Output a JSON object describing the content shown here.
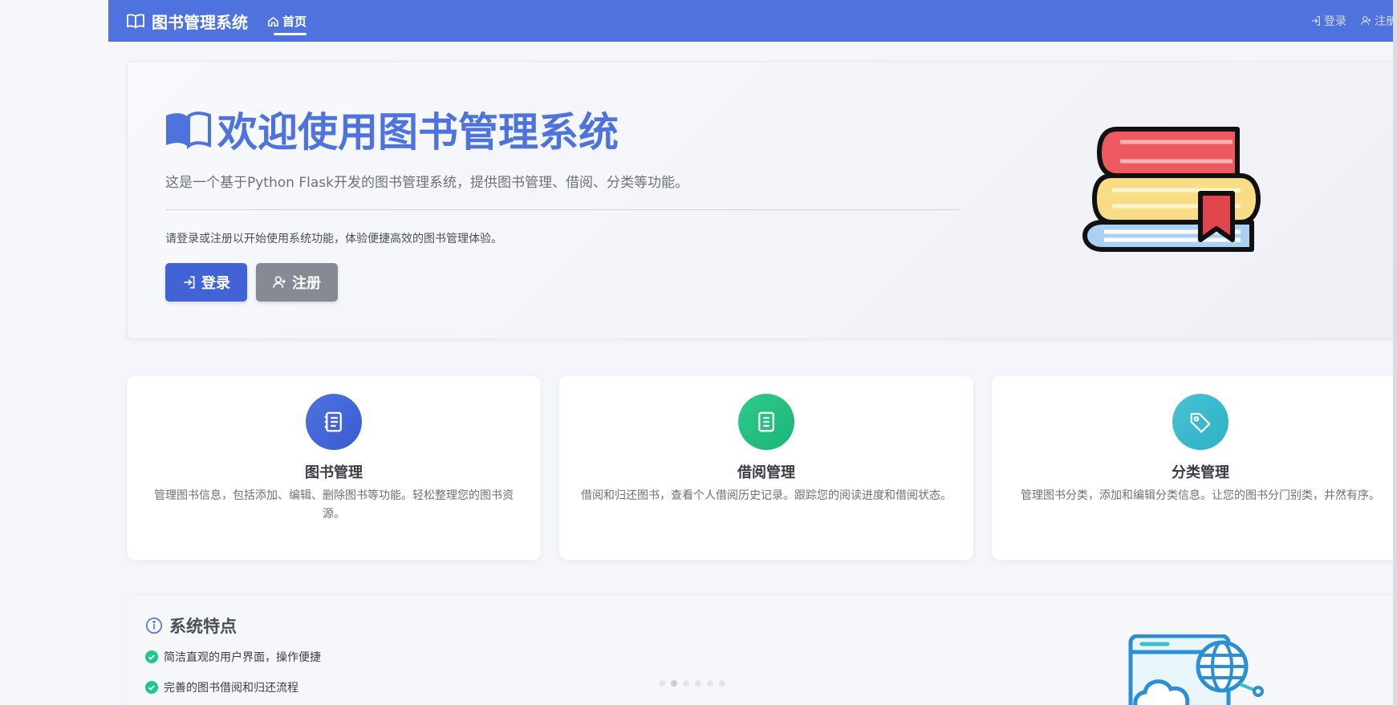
{
  "navbar": {
    "brand": "图书管理系统",
    "home": "首页",
    "login": "登录",
    "register": "注册"
  },
  "hero": {
    "title": "欢迎使用图书管理系统",
    "lead": "这是一个基于Python Flask开发的图书管理系统，提供图书管理、借阅、分类等功能。",
    "sub": "请登录或注册以开始使用系统功能，体验便捷高效的图书管理体验。",
    "login_button": "登录",
    "register_button": "注册"
  },
  "cards": [
    {
      "title": "图书管理",
      "desc": "管理图书信息，包括添加、编辑、删除图书等功能。轻松整理您的图书资源。",
      "icon": "notebook-icon",
      "color": "#4e73df"
    },
    {
      "title": "借阅管理",
      "desc": "借阅和归还图书，查看个人借阅历史记录。跟踪您的阅读进度和借阅状态。",
      "icon": "list-icon",
      "color": "#1cc88a"
    },
    {
      "title": "分类管理",
      "desc": "管理图书分类，添加和编辑分类信息。让您的图书分门别类，井然有序。",
      "icon": "tag-icon",
      "color": "#36b9cc"
    }
  ],
  "features": {
    "title": "系统特点",
    "items": [
      "简洁直观的用户界面，操作便捷",
      "完善的图书借阅和归还流程"
    ]
  },
  "colors": {
    "primary": "#4e73df",
    "secondary": "#858796",
    "success": "#1cc88a",
    "info": "#36b9cc"
  }
}
